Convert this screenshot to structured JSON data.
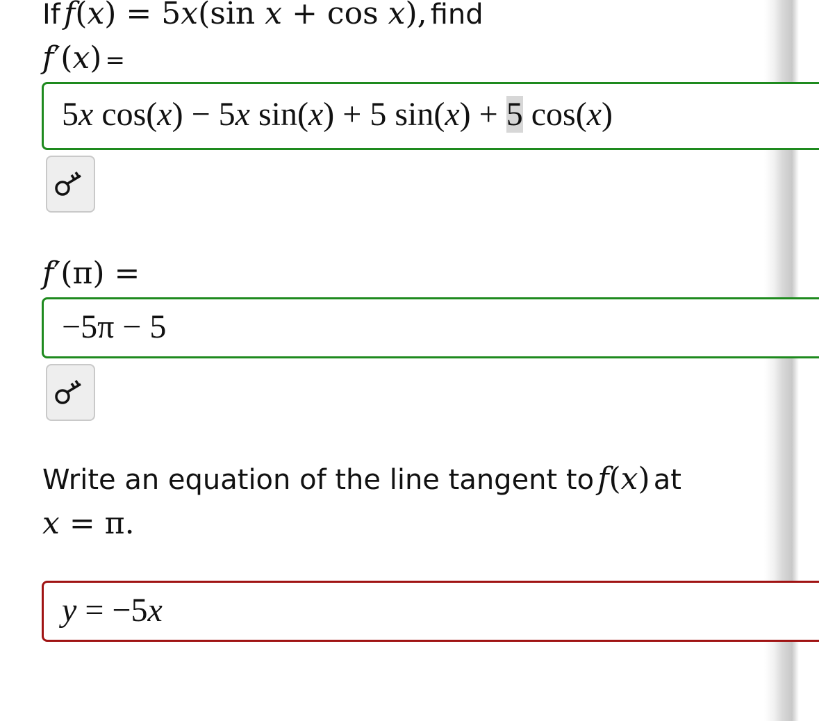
{
  "question": {
    "intro_if": "If",
    "function_def": "f(x) = 5x(sin x + cos x),",
    "find_word": "find",
    "derivative_label": "f′(x)",
    "equals_sign": "=",
    "at_pi_label": "f′(π)",
    "tangent_prompt": "Write an equation of the line tangent to",
    "tangent_func": "f(x)",
    "tangent_at": "at",
    "tangent_point": "x = π."
  },
  "answers": {
    "derivative": {
      "expression_before_cursor": "5x cos(x) − 5x sin(x) + 5 sin(x) + ",
      "expression_highlighted": "5",
      "expression_after_cursor": " cos(x)",
      "status": "correct",
      "status_color": "#1e8a1e"
    },
    "value_at_pi": {
      "expression": "−5π − 5",
      "status": "correct",
      "status_color": "#1e8a1e"
    },
    "tangent_line": {
      "expression": "y = −5x",
      "status": "incorrect",
      "status_color": "#a01313"
    }
  },
  "buttons": {
    "key_icon": "key-icon"
  }
}
